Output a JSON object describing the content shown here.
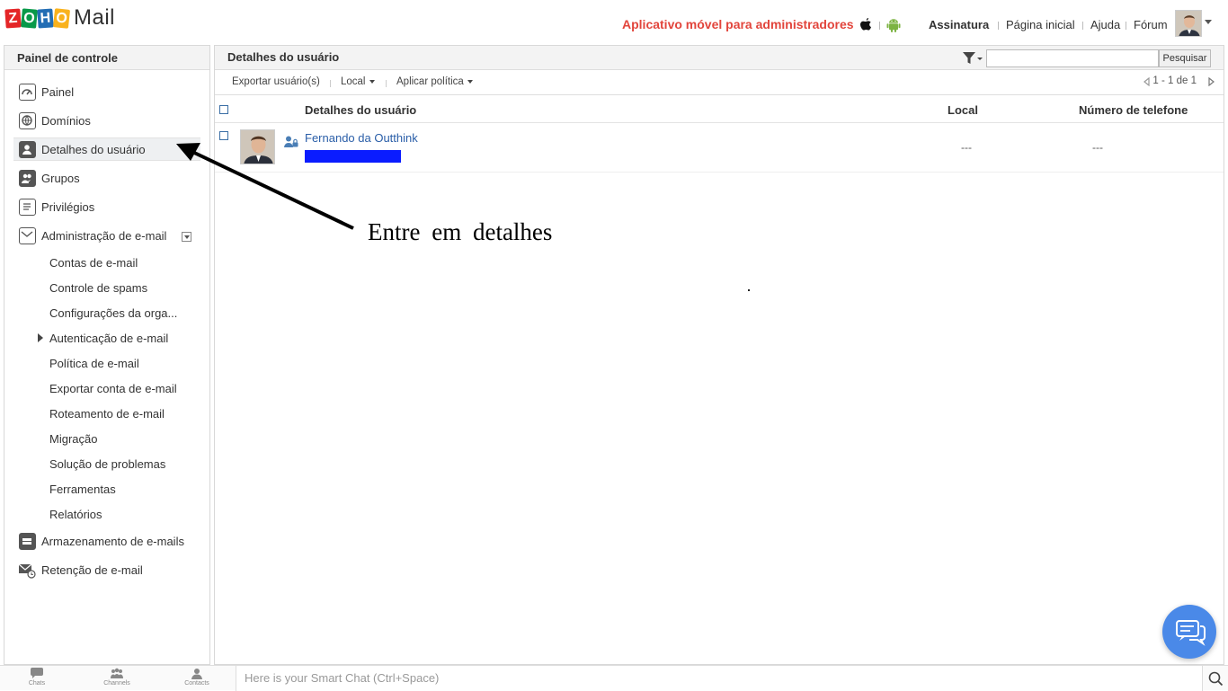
{
  "app": {
    "logo_letters": [
      "Z",
      "O",
      "H",
      "O"
    ],
    "logo_text": "Mail"
  },
  "header": {
    "mobile_promo": "Aplicativo móvel para administradores",
    "links": [
      "Assinatura",
      "Página inicial",
      "Ajuda",
      "Fórum"
    ]
  },
  "sidebar": {
    "title": "Painel de controle",
    "items": [
      {
        "label": "Painel",
        "icon": "dashboard-icon"
      },
      {
        "label": "Domínios",
        "icon": "domains-icon"
      },
      {
        "label": "Detalhes do usuário",
        "icon": "user-icon",
        "active": true
      },
      {
        "label": "Grupos",
        "icon": "groups-icon"
      },
      {
        "label": "Privilégios",
        "icon": "privileges-icon"
      },
      {
        "label": "Administração de e-mail",
        "icon": "mail-admin-icon"
      }
    ],
    "sub_items": [
      "Contas de e-mail",
      "Controle de spams",
      "Configurações da orga...",
      "Autenticação de e-mail",
      "Política de e-mail",
      "Exportar conta de e-mail",
      "Roteamento de e-mail",
      "Migração",
      "Solução de problemas",
      "Ferramentas",
      "Relatórios"
    ],
    "bottom_items": [
      {
        "label": "Armazenamento de e-mails",
        "icon": "storage-icon"
      },
      {
        "label": "Retenção de e-mail",
        "icon": "retention-icon"
      }
    ]
  },
  "main": {
    "title": "Detalhes do usuário",
    "search_button": "Pesquisar",
    "toolbar": {
      "export": "Exportar usuário(s)",
      "local": "Local",
      "apply_policy": "Aplicar política"
    },
    "pager": "1 - 1 de 1",
    "columns": [
      "Detalhes do usuário",
      "Local",
      "Número de telefone"
    ],
    "rows": [
      {
        "name": "Fernando da Outthink",
        "local": "---",
        "phone": "---"
      }
    ]
  },
  "annotation": {
    "text": "Entre em detalhes"
  },
  "bottombar": {
    "tabs": [
      "Chats",
      "Channels",
      "Contacts"
    ],
    "smartchat_placeholder": "Here is your Smart Chat (Ctrl+Space)"
  },
  "colors": {
    "promo": "#e2453c",
    "link": "#2a5ea8",
    "redaction": "#0a1cff",
    "chat_bubble": "#4a89e8"
  }
}
